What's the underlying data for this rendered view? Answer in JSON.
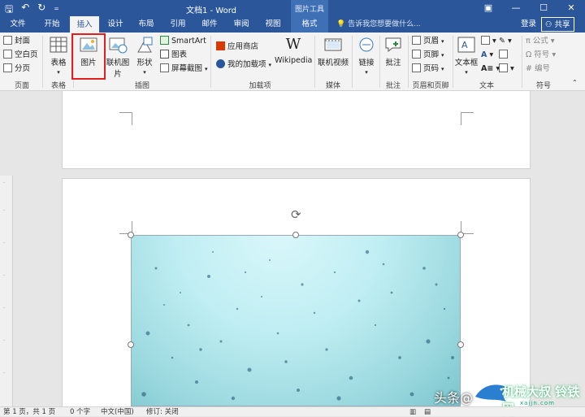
{
  "window": {
    "title": "文档1 - Word",
    "context_tool": "图片工具"
  },
  "tabs": [
    {
      "label": "文件"
    },
    {
      "label": "开始"
    },
    {
      "label": "插入"
    },
    {
      "label": "设计"
    },
    {
      "label": "布局"
    },
    {
      "label": "引用"
    },
    {
      "label": "邮件"
    },
    {
      "label": "审阅"
    },
    {
      "label": "视图"
    },
    {
      "label": "格式"
    }
  ],
  "tellme": "告诉我您想要做什么...",
  "login": "登录",
  "share": "共享",
  "ribbon": {
    "pages": {
      "cover": "封面",
      "blank": "空白页",
      "break": "分页",
      "label": "页面"
    },
    "tables": {
      "table": "表格",
      "label": "表格"
    },
    "illustrations": {
      "picture": "图片",
      "online_picture": "联机图片",
      "shapes": "形状",
      "smartart": "SmartArt",
      "chart": "图表",
      "screenshot": "屏幕截图",
      "label": "插图"
    },
    "addins": {
      "store": "应用商店",
      "my_addins": "我的加载项",
      "wikipedia": "Wikipedia",
      "label": "加载项"
    },
    "media": {
      "online_video": "联机视频",
      "label": "媒体"
    },
    "links": {
      "link": "链接"
    },
    "comments": {
      "comment": "批注",
      "label": "批注"
    },
    "header_footer": {
      "header": "页眉",
      "footer": "页脚",
      "page_number": "页码",
      "label": "页眉和页脚"
    },
    "text": {
      "textbox": "文本框",
      "label": "文本"
    },
    "symbols": {
      "equation": "公式",
      "symbol": "符号",
      "number": "编号",
      "label": "符号"
    }
  },
  "status": {
    "page": "第 1 页，共 1 页",
    "words": "0 个字",
    "lang": "中文(中国)",
    "track": "修订: 关闭"
  },
  "watermark": {
    "a": "头条",
    "b": "@",
    "c": "机械大叔",
    "d": "铃铁网",
    "e": "xajjn.com"
  }
}
